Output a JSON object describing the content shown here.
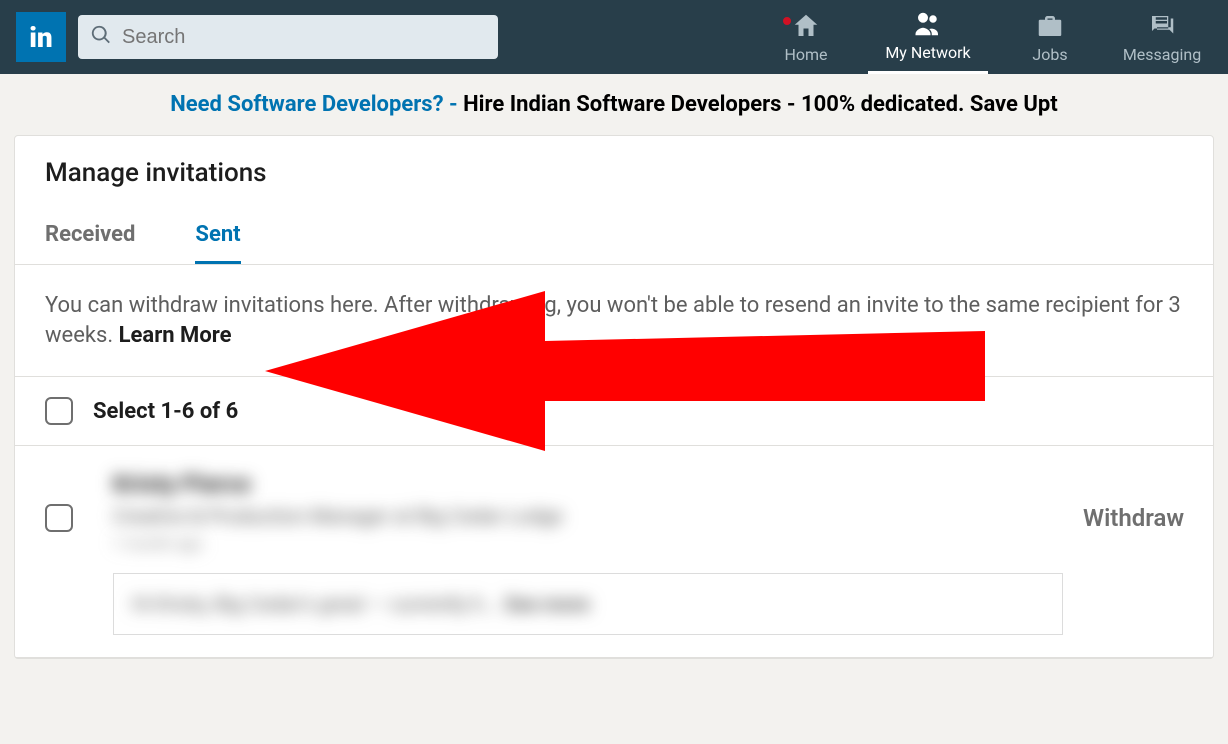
{
  "nav": {
    "search_placeholder": "Search",
    "items": [
      {
        "label": "Home"
      },
      {
        "label": "My Network"
      },
      {
        "label": "Jobs"
      },
      {
        "label": "Messaging"
      }
    ]
  },
  "ad": {
    "link_text": "Need Software Developers? - ",
    "rest_text": "Hire Indian Software Developers - 100% dedicated. Save Upt"
  },
  "panel": {
    "title": "Manage invitations",
    "tabs": {
      "received": "Received",
      "sent": "Sent"
    },
    "info_text": "You can withdraw invitations here. After withdrawing, you won't be able to resend an invite to the same recipient for 3 weeks. ",
    "learn_more": "Learn More",
    "select_label": "Select 1-6 of 6",
    "withdraw_label": "Withdraw",
    "invite": {
      "name": "Kristy Pierce",
      "title": "Creative & Production Manager at Big Cedar Lodge",
      "time": "1 month ago",
      "message_preview": "Hi Kristy, Big Cedar's great — currently h...",
      "see_more": "See more"
    }
  }
}
